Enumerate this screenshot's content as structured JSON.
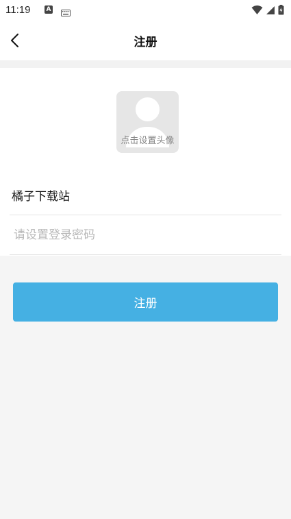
{
  "status_bar": {
    "time": "11:19",
    "notification_letter": "A",
    "icons": [
      "keyboard-icon",
      "wifi-icon",
      "signal-icon",
      "battery-charging-icon"
    ]
  },
  "nav": {
    "back_icon": "chevron-left-icon",
    "title": "注册"
  },
  "avatar": {
    "label": "点击设置头像",
    "icon": "person-placeholder-icon"
  },
  "form": {
    "username_value": "橘子下载站",
    "password_placeholder": "请设置登录密码"
  },
  "actions": {
    "register_label": "注册"
  },
  "colors": {
    "accent": "#45b0e3",
    "background": "#f5f5f5",
    "card": "#ffffff",
    "divider": "#e3e3e3"
  }
}
